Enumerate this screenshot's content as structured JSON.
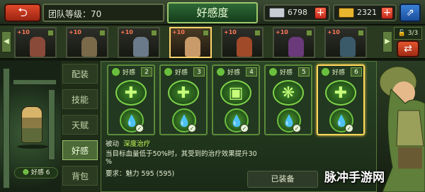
{
  "header": {
    "title": "好感度",
    "team_level_label": "团队等级：70",
    "back_icon": "back-arrow-icon",
    "share_icon": "share-icon"
  },
  "resources": [
    {
      "name": "silver-bars",
      "value": "6798",
      "icon": "silver-bar-icon",
      "color": "#c8cdd3"
    },
    {
      "name": "gold-bars",
      "value": "2321",
      "icon": "gold-bar-icon",
      "color": "#e8b52e"
    }
  ],
  "roster": {
    "capacity": "3/3",
    "cards": [
      {
        "badge": "+10",
        "sprite_color": "#8a4a3a"
      },
      {
        "badge": "+10",
        "sprite_color": "#7a6a4a"
      },
      {
        "badge": "+10",
        "sprite_color": "#6a7a8a"
      },
      {
        "badge": "+10",
        "sprite_color": "#c99a6a"
      },
      {
        "badge": "+10",
        "sprite_color": "#a04a2a"
      },
      {
        "badge": "+10",
        "sprite_color": "#6a3a7a"
      },
      {
        "badge": "+10",
        "sprite_color": "#3a5a6a"
      }
    ]
  },
  "side_tabs": [
    "配装",
    "技能",
    "天赋",
    "好感",
    "背包"
  ],
  "active_tab": 3,
  "character": {
    "favor_label": "好感 6"
  },
  "favor_slots": [
    {
      "label": "好感",
      "level": "2",
      "glyph": "✚"
    },
    {
      "label": "好感",
      "level": "3",
      "glyph": "✚"
    },
    {
      "label": "好感",
      "level": "4",
      "glyph": "▣"
    },
    {
      "label": "好感",
      "level": "5",
      "glyph": "❋"
    },
    {
      "label": "好感",
      "level": "6",
      "glyph": "✚"
    }
  ],
  "skill": {
    "type": "被动",
    "name": "深度治疗",
    "description": "当目标血量低于50%时，其受到的治疗效果提升30",
    "percent": "%",
    "requirement": "要求：魅力 595 (595)",
    "status": "已装备"
  },
  "watermark": "脉冲手游网"
}
